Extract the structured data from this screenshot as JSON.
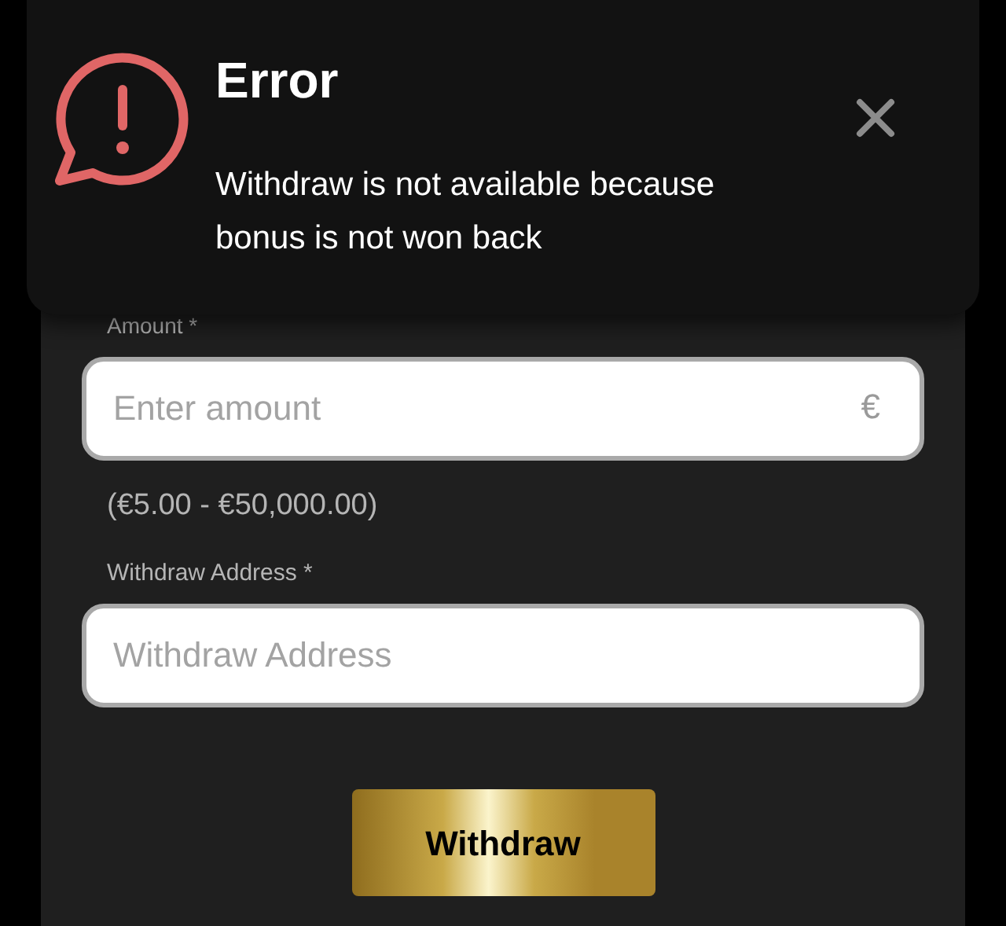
{
  "toast": {
    "title": "Error",
    "message": "Withdraw is not available because bonus is not won back"
  },
  "form": {
    "amount": {
      "label": "Amount *",
      "placeholder": "Enter amount",
      "currency": "€"
    },
    "range": "(€5.00 - €50,000.00)",
    "address": {
      "label": "Withdraw Address *",
      "placeholder": "Withdraw Address"
    },
    "submit": "Withdraw"
  }
}
